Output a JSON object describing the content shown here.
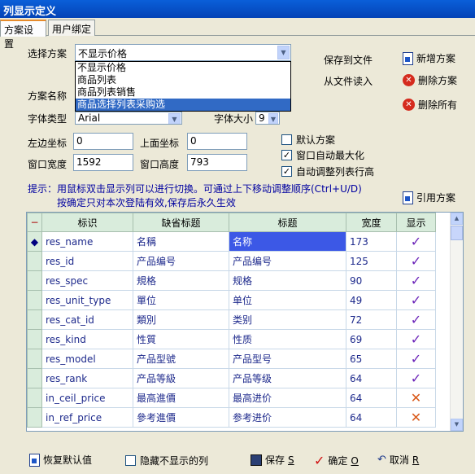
{
  "window": {
    "title": "列显示定义"
  },
  "tabs": [
    {
      "label": "方案设置",
      "active": true
    },
    {
      "label": "用户绑定",
      "active": false
    }
  ],
  "form": {
    "scheme_label": "选择方案",
    "scheme_value": "不显示价格",
    "scheme_options": [
      "不显示价格",
      "商品列表",
      "商品列表销售",
      "商品选择列表采购选"
    ],
    "scheme_options_selected_index": 3,
    "name_label": "方案名称",
    "font_label": "字体类型",
    "font_value": "Arial",
    "fontsize_label": "字体大小",
    "fontsize_value": "9",
    "left_label": "左边坐标",
    "left_value": "0",
    "top_label": "上面坐标",
    "top_value": "0",
    "width_label": "窗口宽度",
    "width_value": "1592",
    "height_label": "窗口高度",
    "height_value": "793"
  },
  "actions": {
    "save_to_file": "保存到文件",
    "read_from_file": "从文件读入",
    "new_scheme": "新增方案",
    "delete_scheme": "删除方案",
    "delete_all": "删除所有",
    "apply_scheme": "引用方案"
  },
  "checks": {
    "default_scheme": {
      "label": "默认方案",
      "checked": false
    },
    "auto_max": {
      "label": "窗口自动最大化",
      "checked": true
    },
    "auto_row_height": {
      "label": "自动调整列表行高",
      "checked": true
    }
  },
  "hint": {
    "line1": "提示：用鼠标双击显示列可以进行切换。可通过上下移动调整顺序(Ctrl+U/D)",
    "line2": "按确定只对本次登陆有效,保存后永久生效"
  },
  "grid": {
    "indicator_header": "−",
    "headers": [
      "标识",
      "缺省标题",
      "标题",
      "宽度",
      "显示"
    ],
    "rows": [
      {
        "id": "res_name",
        "default": "名稱",
        "title": "名称",
        "width": "173",
        "show": true
      },
      {
        "id": "res_id",
        "default": "产品编号",
        "title": "产品编号",
        "width": "125",
        "show": true
      },
      {
        "id": "res_spec",
        "default": "規格",
        "title": "规格",
        "width": "90",
        "show": true
      },
      {
        "id": "res_unit_type",
        "default": "單位",
        "title": "单位",
        "width": "49",
        "show": true
      },
      {
        "id": "res_cat_id",
        "default": "類別",
        "title": "类别",
        "width": "72",
        "show": true
      },
      {
        "id": "res_kind",
        "default": "性質",
        "title": "性质",
        "width": "69",
        "show": true
      },
      {
        "id": "res_model",
        "default": "产品型號",
        "title": "产品型号",
        "width": "65",
        "show": true
      },
      {
        "id": "res_rank",
        "default": "产品等級",
        "title": "产品等级",
        "width": "64",
        "show": true
      },
      {
        "id": "in_ceil_price",
        "default": "最高進價",
        "title": "最高进价",
        "width": "64",
        "show": false
      },
      {
        "id": "in_ref_price",
        "default": "參考進價",
        "title": "参考进价",
        "width": "64",
        "show": false
      }
    ]
  },
  "footer": {
    "restore_default": "恢复默认值",
    "hide_hidden": "隐藏不显示的列",
    "save": "保存",
    "save_key": "S",
    "ok": "确定",
    "ok_key": "O",
    "cancel": "取消",
    "cancel_key": "R"
  },
  "colors": {
    "accent": "#316ac5",
    "check_mark": "#6a22b8",
    "cross_mark": "#d9591a",
    "hint_text": "#0000a0"
  }
}
